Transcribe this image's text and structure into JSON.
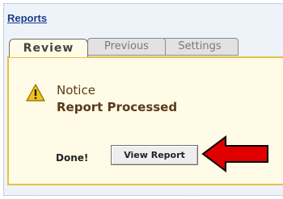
{
  "header": {
    "link_label": "Reports"
  },
  "tabs": [
    {
      "label": "Review",
      "active": true
    },
    {
      "label": "Previous",
      "active": false
    },
    {
      "label": "Settings",
      "active": false
    }
  ],
  "notice": {
    "title": "Notice",
    "message": "Report Processed",
    "icon": "warning-icon"
  },
  "actions": {
    "done_label": "Done!",
    "view_report_label": "View Report"
  },
  "colors": {
    "link": "#1c3d8a",
    "notice_border": "#e9bf45",
    "notice_bg": "#fffbe6",
    "arrow": "#e00000"
  }
}
